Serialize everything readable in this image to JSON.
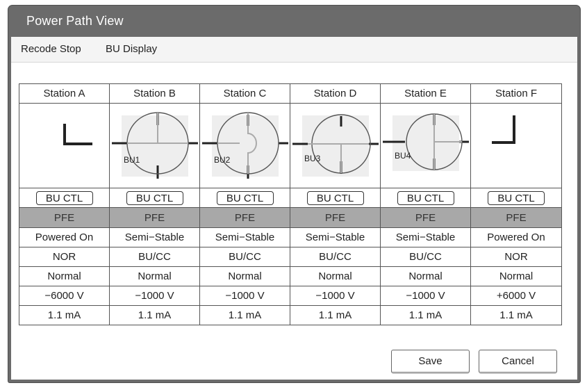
{
  "window": {
    "title": "Power Path View"
  },
  "menu": {
    "items": [
      "Recode Stop",
      "BU Display"
    ]
  },
  "stations": [
    {
      "name": "Station A",
      "diagram": "corner-left",
      "bu_label": "",
      "ctl": "BU CTL",
      "pfe": "PFE",
      "state": "Powered On",
      "mode": "NOR",
      "status": "Normal",
      "voltage": "−6000 V",
      "current": "1.1 mA"
    },
    {
      "name": "Station B",
      "diagram": "branching-unit",
      "bu_label": "BU1",
      "ctl": "BU CTL",
      "pfe": "PFE",
      "state": "Semi−Stable",
      "mode": "BU/CC",
      "status": "Normal",
      "voltage": "−1000 V",
      "current": "1.1 mA"
    },
    {
      "name": "Station C",
      "diagram": "branching-unit",
      "bu_label": "BU2",
      "ctl": "BU CTL",
      "pfe": "PFE",
      "state": "Semi−Stable",
      "mode": "BU/CC",
      "status": "Normal",
      "voltage": "−1000 V",
      "current": "1.1 mA"
    },
    {
      "name": "Station D",
      "diagram": "branching-unit",
      "bu_label": "BU3",
      "ctl": "BU CTL",
      "pfe": "PFE",
      "state": "Semi−Stable",
      "mode": "BU/CC",
      "status": "Normal",
      "voltage": "−1000 V",
      "current": "1.1 mA"
    },
    {
      "name": "Station E",
      "diagram": "branching-unit",
      "bu_label": "BU4",
      "ctl": "BU CTL",
      "pfe": "PFE",
      "state": "Semi−Stable",
      "mode": "BU/CC",
      "status": "Normal",
      "voltage": "−1000 V",
      "current": "1.1 mA"
    },
    {
      "name": "Station F",
      "diagram": "corner-right",
      "bu_label": "",
      "ctl": "BU CTL",
      "pfe": "PFE",
      "state": "Powered On",
      "mode": "NOR",
      "status": "Normal",
      "voltage": "+6000 V",
      "current": "1.1 mA"
    }
  ],
  "buttons": {
    "save": "Save",
    "cancel": "Cancel"
  }
}
